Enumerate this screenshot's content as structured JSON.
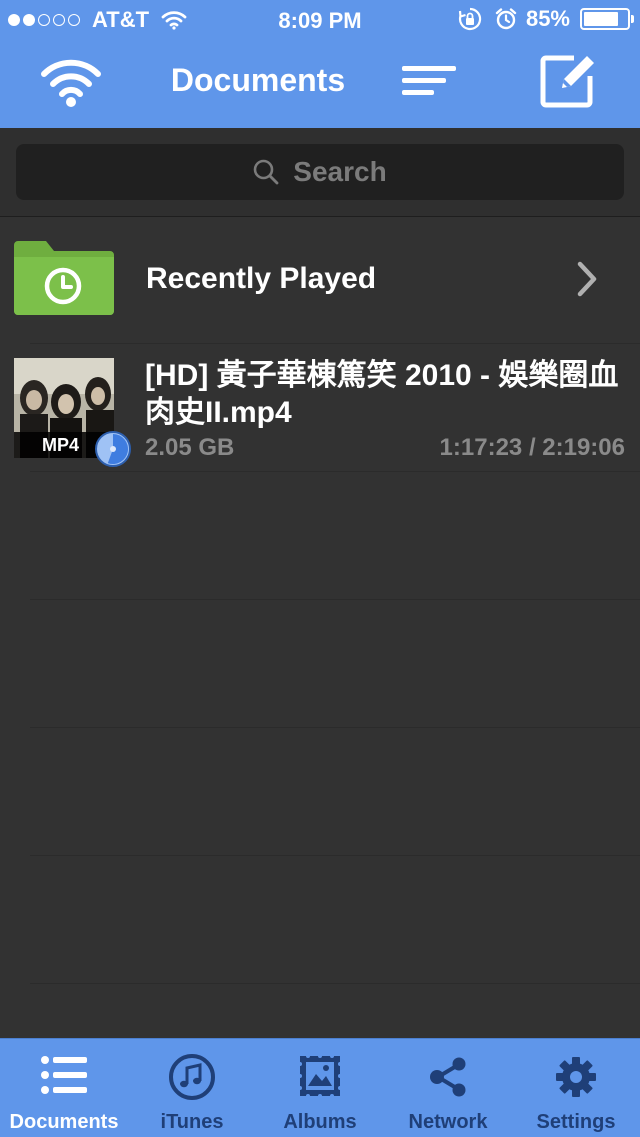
{
  "status_bar": {
    "carrier": "AT&T",
    "signal_bars": 2,
    "time": "8:09 PM",
    "battery_percent": "85%",
    "battery_level": 0.85
  },
  "nav": {
    "title": "Documents",
    "left_icon": "wifi-icon",
    "sort_icon": "sort-lines-icon",
    "edit_icon": "edit-pencil-icon"
  },
  "search": {
    "placeholder": "Search"
  },
  "list": {
    "folder": {
      "label": "Recently Played",
      "icon": "folder-clock-icon"
    },
    "files": [
      {
        "title": "[HD] 黃子華棟篤笑 2010 - 娛樂圈血肉史II.mp4",
        "badge": "MP4",
        "size": "2.05 GB",
        "position": "1:17:23 / 2:19:06",
        "progress": 0.556
      }
    ]
  },
  "tabs": [
    {
      "label": "Documents",
      "icon": "list-icon",
      "active": true
    },
    {
      "label": "iTunes",
      "icon": "music-note-icon",
      "active": false
    },
    {
      "label": "Albums",
      "icon": "photo-stamp-icon",
      "active": false
    },
    {
      "label": "Network",
      "icon": "share-icon",
      "active": false
    },
    {
      "label": "Settings",
      "icon": "gear-icon",
      "active": false
    }
  ],
  "colors": {
    "accent": "#5f96ea",
    "background": "#323232",
    "folder": "#7cc04a",
    "inactive_tab": "#1f3f78"
  }
}
